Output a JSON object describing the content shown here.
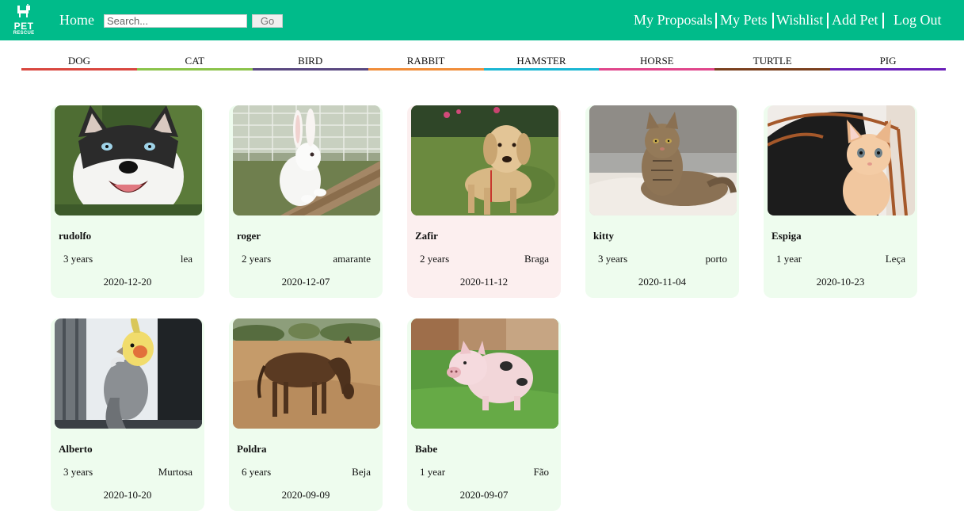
{
  "header": {
    "logo_text_1": "PET",
    "logo_text_2": "RESCUE",
    "home_label": "Home",
    "search_placeholder": "Search...",
    "go_label": "Go",
    "nav": [
      "My Proposals",
      "My Pets",
      "Wishlist",
      "Add Pet",
      "Log Out"
    ],
    "background": "#00bb8a"
  },
  "categories": [
    {
      "label": "DOG",
      "color": "#d9473f"
    },
    {
      "label": "CAT",
      "color": "#8bc34a"
    },
    {
      "label": "BIRD",
      "color": "#5a4880"
    },
    {
      "label": "RABBIT",
      "color": "#f08d3a"
    },
    {
      "label": "HAMSTER",
      "color": "#1bb6d3"
    },
    {
      "label": "HORSE",
      "color": "#e0468b"
    },
    {
      "label": "TURTLE",
      "color": "#7a3f1e"
    },
    {
      "label": "PIG",
      "color": "#6a1fb8"
    }
  ],
  "pets": [
    {
      "name": "rudolfo",
      "age": "3 years",
      "location": "lea",
      "date": "2020-12-20",
      "photo": "husky-dog-photo",
      "highlight": false
    },
    {
      "name": "roger",
      "age": "2 years",
      "location": "amarante",
      "date": "2020-12-07",
      "photo": "white-rabbit-photo",
      "highlight": false
    },
    {
      "name": "Zafir",
      "age": "2 years",
      "location": "Braga",
      "date": "2020-11-12",
      "photo": "golden-dog-photo",
      "highlight": true
    },
    {
      "name": "kitty",
      "age": "3 years",
      "location": "porto",
      "date": "2020-11-04",
      "photo": "tabby-cat-photo",
      "highlight": false
    },
    {
      "name": "Espiga",
      "age": "1 year",
      "location": "Leça",
      "date": "2020-10-23",
      "photo": "orange-kitten-photo",
      "highlight": false
    },
    {
      "name": "Alberto",
      "age": "3 years",
      "location": "Murtosa",
      "date": "2020-10-20",
      "photo": "cockatiel-photo",
      "highlight": false
    },
    {
      "name": "Poldra",
      "age": "6 years",
      "location": "Beja",
      "date": "2020-09-09",
      "photo": "brown-horse-photo",
      "highlight": false
    },
    {
      "name": "Babe",
      "age": "1 year",
      "location": "Fão",
      "date": "2020-09-07",
      "photo": "piglet-photo",
      "highlight": false
    }
  ]
}
